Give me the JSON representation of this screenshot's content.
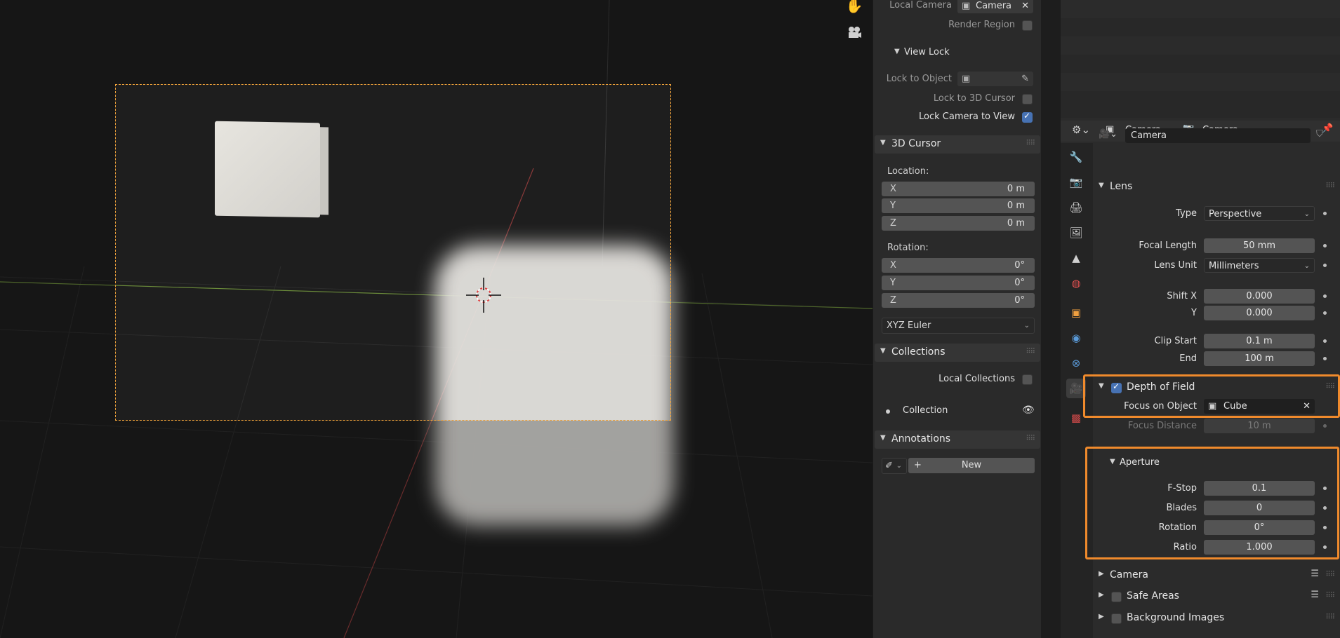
{
  "npanel": {
    "local_camera_label": "Local Camera",
    "local_camera_value": "Camera",
    "render_region_label": "Render Region",
    "view_lock_title": "View Lock",
    "lock_to_object_label": "Lock to Object",
    "lock_to_cursor_label": "Lock to 3D Cursor",
    "lock_camera_label": "Lock Camera to View",
    "cursor_title": "3D Cursor",
    "location_label": "Location:",
    "location": [
      {
        "axis": "X",
        "value": "0 m"
      },
      {
        "axis": "Y",
        "value": "0 m"
      },
      {
        "axis": "Z",
        "value": "0 m"
      }
    ],
    "rotation_label": "Rotation:",
    "rotation": [
      {
        "axis": "X",
        "value": "0°"
      },
      {
        "axis": "Y",
        "value": "0°"
      },
      {
        "axis": "Z",
        "value": "0°"
      }
    ],
    "rotation_mode": "XYZ Euler",
    "collections_title": "Collections",
    "local_collections_label": "Local Collections",
    "collection_name": "Collection",
    "annotations_title": "Annotations",
    "new_button": "New"
  },
  "props": {
    "breadcrumb_object": "Camera",
    "breadcrumb_data": "Camera",
    "datablock_name": "Camera",
    "lens_title": "Lens",
    "type_label": "Type",
    "type_value": "Perspective",
    "focal_length_label": "Focal Length",
    "focal_length_value": "50 mm",
    "lens_unit_label": "Lens Unit",
    "lens_unit_value": "Millimeters",
    "shift_x_label": "Shift X",
    "shift_x_value": "0.000",
    "shift_y_label": "Y",
    "shift_y_value": "0.000",
    "clip_start_label": "Clip Start",
    "clip_start_value": "0.1 m",
    "clip_end_label": "End",
    "clip_end_value": "100 m",
    "dof_title": "Depth of Field",
    "focus_object_label": "Focus on Object",
    "focus_object_value": "Cube",
    "focus_distance_label": "Focus Distance",
    "focus_distance_value": "10 m",
    "aperture_title": "Aperture",
    "fstop_label": "F-Stop",
    "fstop_value": "0.1",
    "blades_label": "Blades",
    "blades_value": "0",
    "aperture_rotation_label": "Rotation",
    "aperture_rotation_value": "0°",
    "ratio_label": "Ratio",
    "ratio_value": "1.000",
    "camera_section": "Camera",
    "safe_areas_section": "Safe Areas",
    "background_images_section": "Background Images"
  },
  "colors": {
    "highlight": "#f08a2c",
    "accent": "#4772b3",
    "camera_frame": "#f2a33a"
  }
}
